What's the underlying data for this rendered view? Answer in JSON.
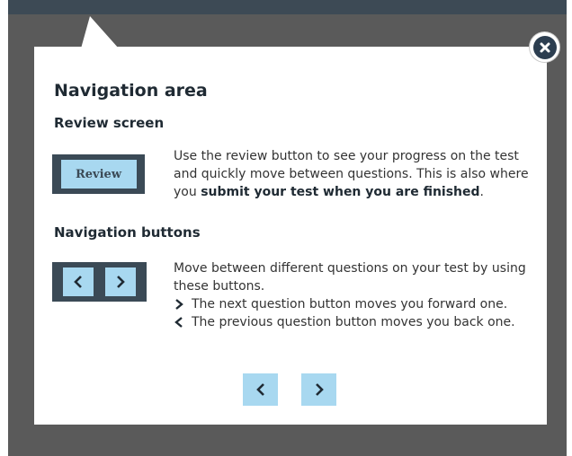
{
  "modal": {
    "title": "Navigation area",
    "review_section": {
      "heading": "Review screen",
      "button_label": "Review",
      "description_part1": "Use the review button to see your progress on the test and quickly move between questions. This is also where you ",
      "description_bold": "submit your test when you are finished",
      "description_end": "."
    },
    "nav_section": {
      "heading": "Navigation buttons",
      "description": "Move between different questions on your test by using these buttons.",
      "next_note": "The next question button moves you forward one.",
      "prev_note": "The previous question button moves you back one."
    }
  },
  "icons": {
    "close": "close-icon",
    "prev": "chevron-left-icon",
    "next": "chevron-right-icon"
  },
  "colors": {
    "overlay": "#5a5a5a",
    "dark_slate": "#3b4a56",
    "light_blue": "#a8d8f0"
  }
}
